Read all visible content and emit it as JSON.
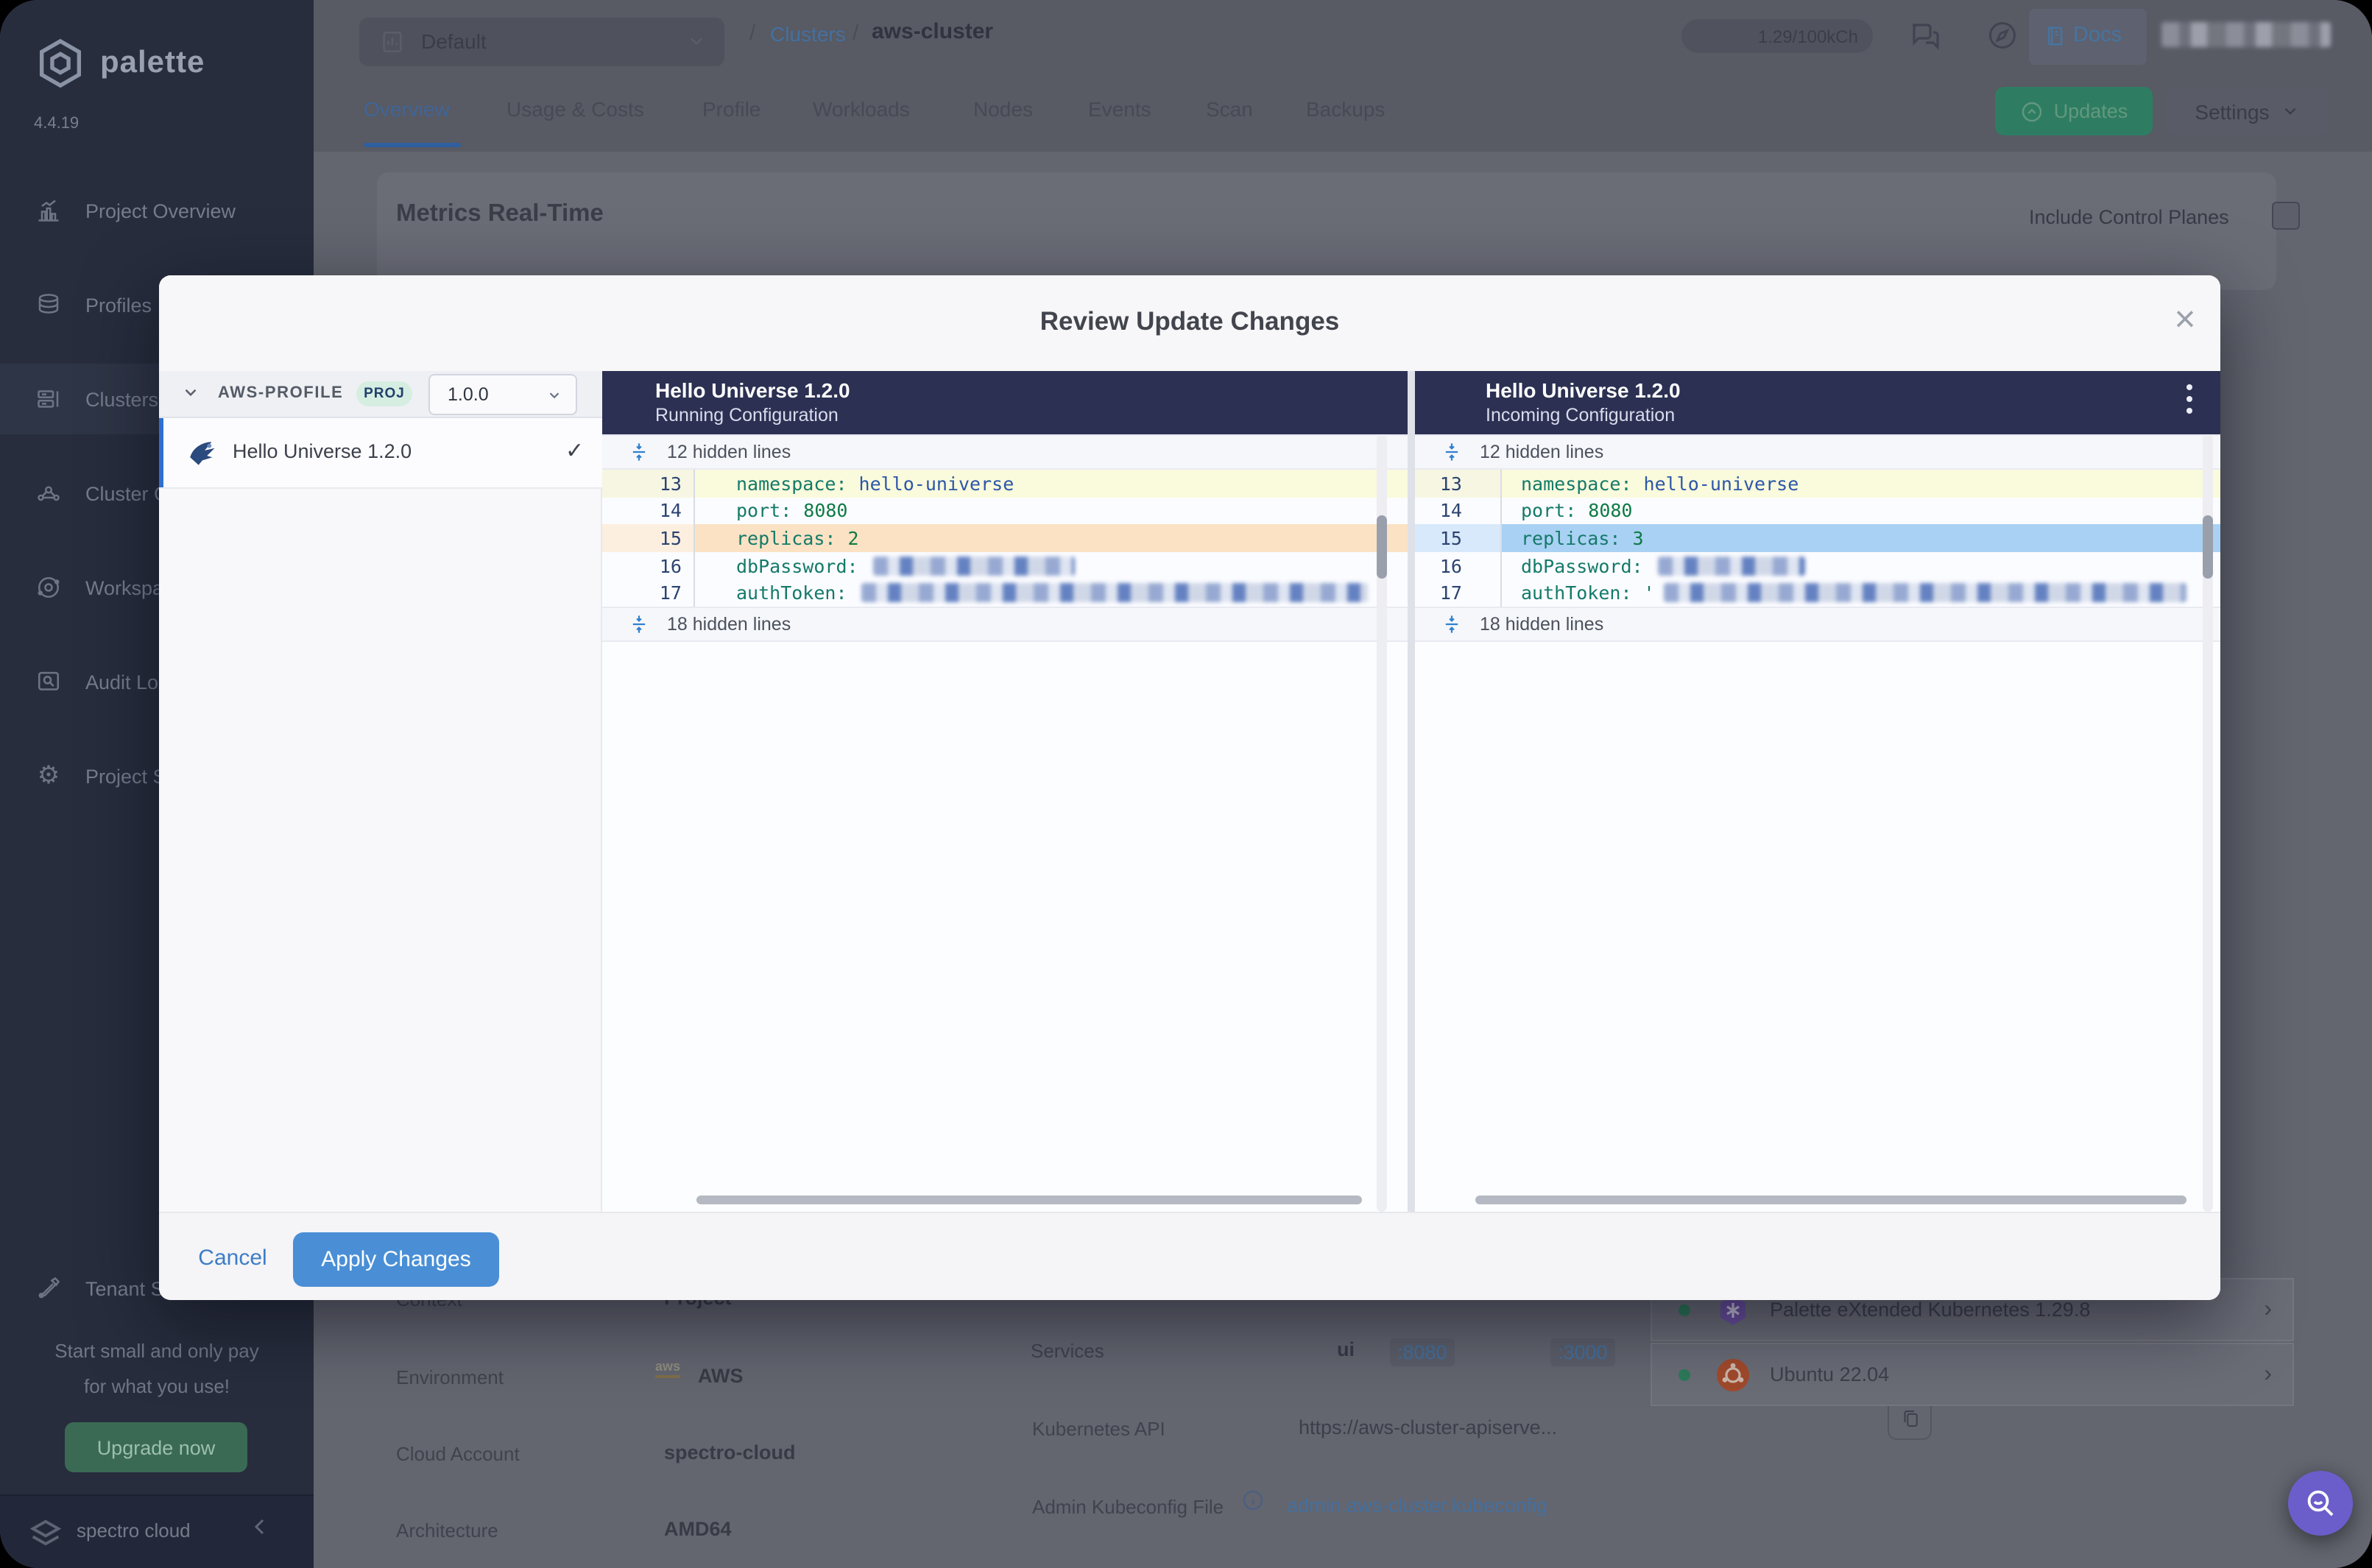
{
  "brand": {
    "name": "palette",
    "version": "4.4.19",
    "footer": "spectro cloud"
  },
  "sidebar": {
    "items": [
      {
        "label": "Project Overview"
      },
      {
        "label": "Profiles"
      },
      {
        "label": "Clusters"
      },
      {
        "label": "Cluster Groups"
      },
      {
        "label": "Workspaces"
      },
      {
        "label": "Audit Logs"
      },
      {
        "label": "Project Settings"
      }
    ],
    "tenant": "Tenant Settings",
    "promo_line1": "Start small and only pay",
    "promo_line2": "for what you use!",
    "upgrade": "Upgrade now"
  },
  "header": {
    "project_selector": "Default",
    "breadcrumb": {
      "separator": "/",
      "link": "Clusters",
      "current": "aws-cluster"
    },
    "credits": "1.29/100kCh",
    "docs": "Docs",
    "tabs": [
      "Overview",
      "Usage & Costs",
      "Profile",
      "Workloads",
      "Nodes",
      "Events",
      "Scan",
      "Backups"
    ],
    "updates": "Updates",
    "settings": "Settings"
  },
  "content": {
    "metrics_title": "Metrics Real-Time",
    "include_control_planes": "Include Control Planes",
    "details": [
      {
        "label": "Context",
        "value": "Project"
      },
      {
        "label": "Environment",
        "value": "AWS"
      },
      {
        "label": "Cloud Account",
        "value": "spectro-cloud"
      },
      {
        "label": "Architecture",
        "value": "AMD64"
      }
    ],
    "services": {
      "label": "Services",
      "name": "ui",
      "ports": [
        ":8080",
        ":3000"
      ]
    },
    "kubernetes_api": {
      "label": "Kubernetes API",
      "value": "https://aws-cluster-apiserve..."
    },
    "kubeconfig": {
      "label": "Admin Kubeconfig File",
      "value": "admin.aws-cluster.kubeconfig"
    },
    "packs": [
      {
        "name": "Palette eXtended Kubernetes 1.29.8"
      },
      {
        "name": "Ubuntu 22.04"
      }
    ]
  },
  "modal": {
    "title": "Review Update Changes",
    "profile": {
      "name": "AWS-PROFILE",
      "scope": "PROJ",
      "version": "1.0.0"
    },
    "pack": "Hello Universe 1.2.0",
    "left_panel": {
      "title": "Hello Universe 1.2.0",
      "subtitle": "Running Configuration"
    },
    "right_panel": {
      "title": "Hello Universe 1.2.0",
      "subtitle": "Incoming Configuration"
    },
    "hidden_top": "12 hidden lines",
    "hidden_bottom": "18 hidden lines",
    "left_lines": [
      {
        "no": "13",
        "key": "namespace:",
        "value": "hello-universe"
      },
      {
        "no": "14",
        "key": "port:",
        "value": "8080"
      },
      {
        "no": "15",
        "key": "replicas:",
        "value": "2"
      },
      {
        "no": "16",
        "key": "dbPassword:",
        "value": ""
      },
      {
        "no": "17",
        "key": "authToken:",
        "value": ""
      }
    ],
    "right_lines": [
      {
        "no": "13",
        "key": "namespace:",
        "value": "hello-universe"
      },
      {
        "no": "14",
        "key": "port:",
        "value": "8080"
      },
      {
        "no": "15",
        "key": "replicas:",
        "value": "3"
      },
      {
        "no": "16",
        "key": "dbPassword:",
        "value": ""
      },
      {
        "no": "17",
        "key": "authToken:",
        "value": "'"
      }
    ],
    "cancel": "Cancel",
    "apply": "Apply Changes"
  },
  "colors": {
    "accent_blue": "#4a8fd6",
    "added_bg": "#a9d1f3",
    "removed_bg": "#fbe2c4",
    "context_bg": "#fafadc",
    "diff_header": "#2c3153",
    "updates_green": "#2e7d62",
    "fab_purple": "#6b5ecb"
  }
}
